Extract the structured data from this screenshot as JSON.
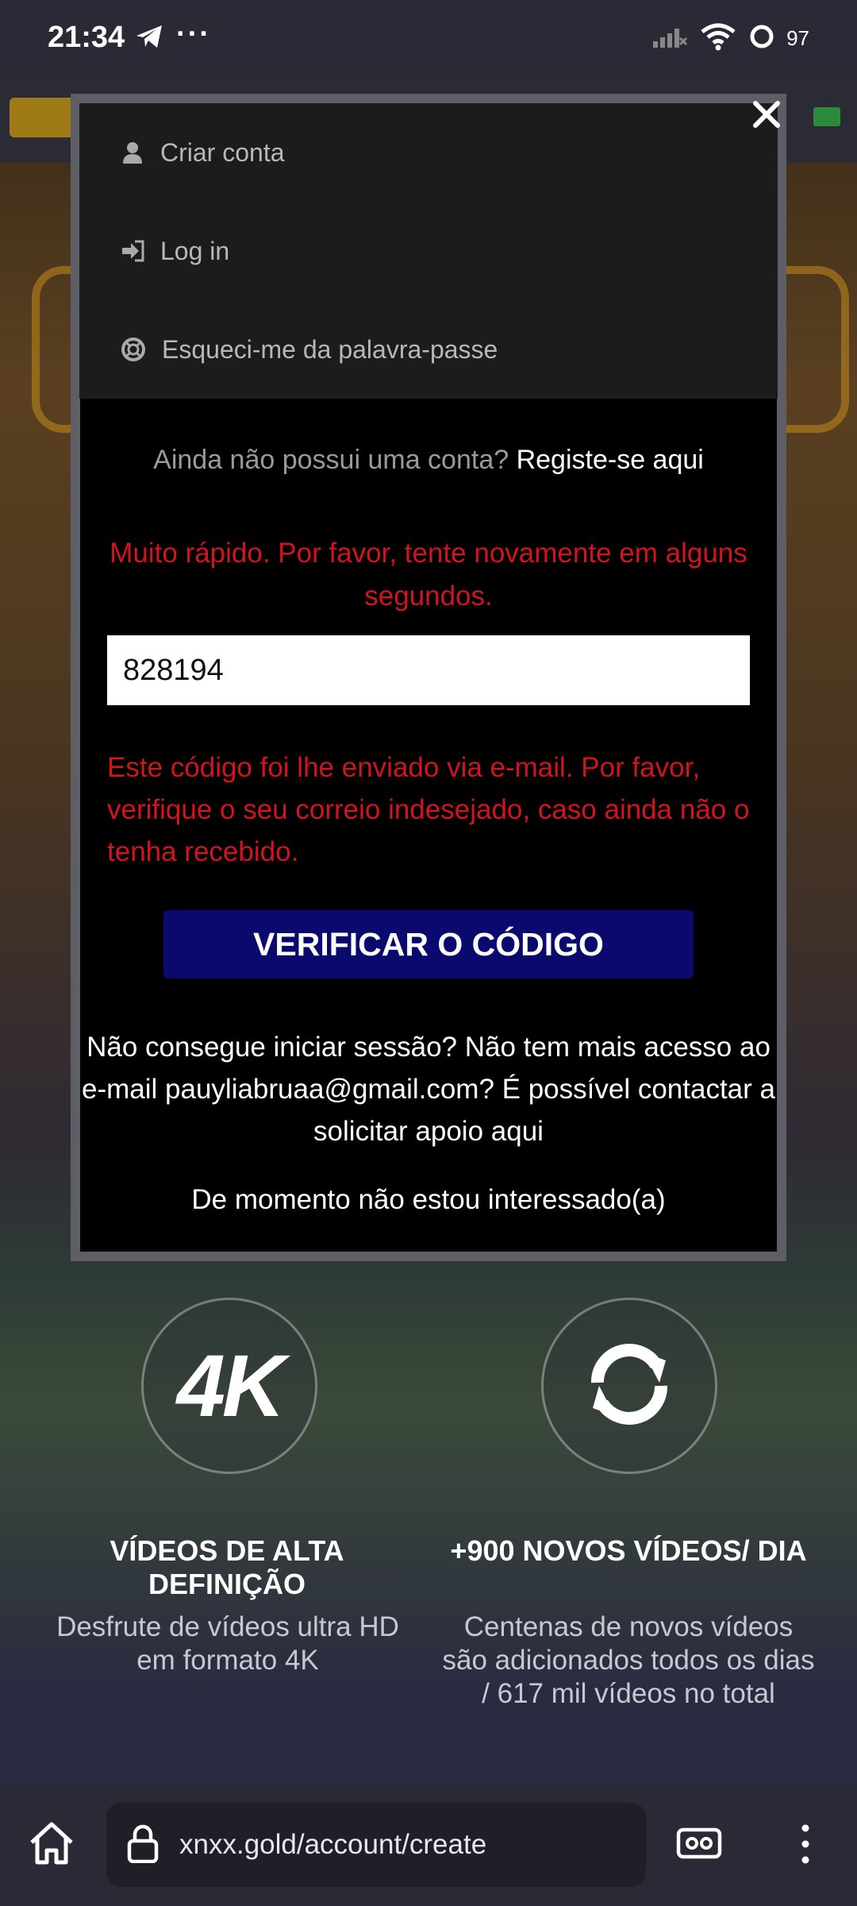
{
  "status_bar": {
    "time": "21:34",
    "more": "···",
    "battery": "97",
    "icons": [
      "telegram-icon",
      "signal-icon",
      "wifi-icon",
      "battery-icon"
    ]
  },
  "modal": {
    "menu": {
      "create_account": "Criar conta",
      "login": "Log in",
      "forgot_password": "Esqueci-me da palavra-passe"
    },
    "no_account_prefix": "Ainda não possui uma conta?",
    "register_link": "Registe-se aqui",
    "rate_error": "Muito rápido. Por favor, tente novamente em alguns segundos.",
    "code_value": "828194",
    "email_note": "Este código foi lhe enviado via e-mail. Por favor, verifique o seu correio indesejado, caso ainda não o tenha recebido.",
    "verify_button": "VERIFICAR O CÓDIGO",
    "help_text": "Não consegue iniciar sessão? Não tem mais acesso ao e-mail pauyliabruaa@gmail.com? É possível contactar a solicitar apoio aqui",
    "not_interested": "De momento não estou interessado(a)"
  },
  "features": {
    "left": {
      "badge": "4K",
      "title": "VÍDEOS DE ALTA DEFINIÇÃO",
      "desc": "Desfrute de vídeos ultra HD em formato 4K"
    },
    "right": {
      "icon": "refresh-icon",
      "title": "+900 NOVOS VÍDEOS/ DIA",
      "desc": "Centenas de novos vídeos são adicionados todos os dias / 617 mil vídeos no total"
    }
  },
  "browser": {
    "url": "xnxx.gold/account/create"
  },
  "colors": {
    "error_red": "#d2141e",
    "button_navy": "#0a0a6e",
    "modal_border": "#5e5e66"
  }
}
